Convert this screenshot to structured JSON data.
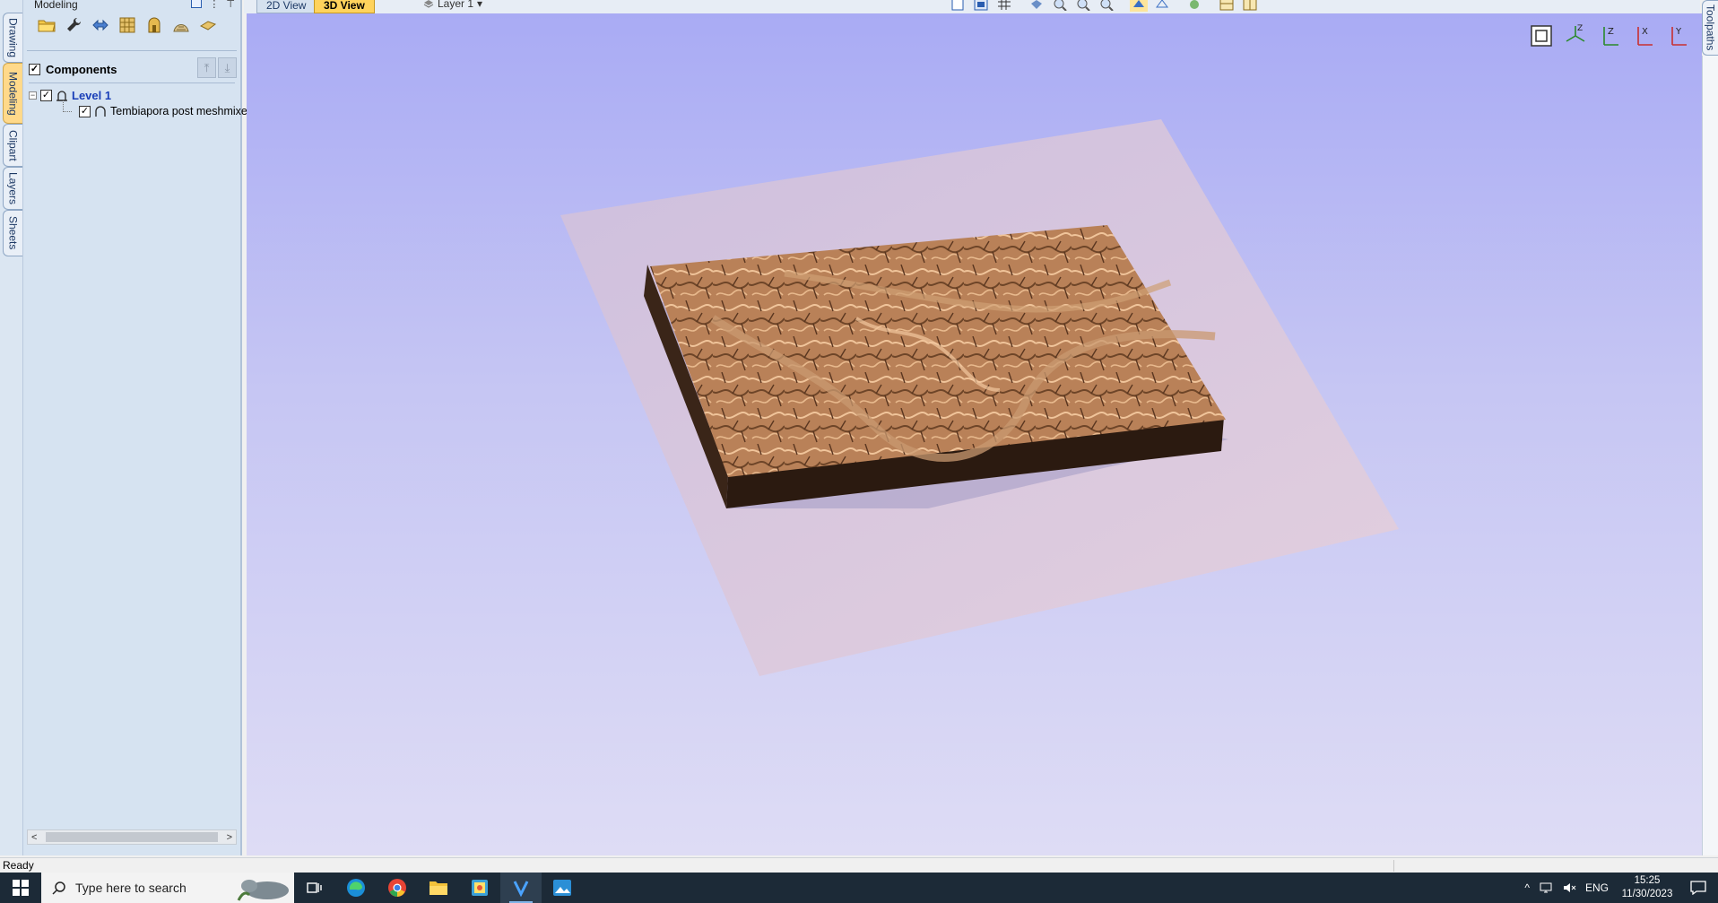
{
  "panel": {
    "title": "Modeling",
    "pin_glyph": "⋮",
    "close_glyph": "⊤",
    "tools": [
      {
        "icon": "open-folder-icon"
      },
      {
        "icon": "wrench-icon"
      },
      {
        "icon": "move-arrows-icon"
      },
      {
        "icon": "grid-texture-icon"
      },
      {
        "icon": "shape-editor-icon"
      },
      {
        "icon": "dome-icon"
      },
      {
        "icon": "flat-plane-icon"
      }
    ],
    "components_label": "Components",
    "sort_up": "⤒",
    "sort_down": "⤓",
    "tree": {
      "level_label": "Level 1",
      "expander": "−",
      "item_label": "Tembiapora post meshmixer"
    },
    "scroll_left": "<",
    "scroll_right": ">"
  },
  "side_tabs": [
    "Drawing",
    "Modeling",
    "Clipart",
    "Layers",
    "Sheets"
  ],
  "active_side_tab": "Modeling",
  "right_tab": "Toolpaths",
  "view_tabs": {
    "tab_2d": "2D View",
    "tab_3d": "3D View"
  },
  "layer_selector": {
    "label": "Layer 1",
    "arrow": "▾"
  },
  "top_toolbar_icons": [
    "page-icon",
    "fit-icon",
    "grid-icon",
    "snap-icon",
    "zoom-in-icon",
    "zoom-box-icon",
    "zoom-out-icon",
    "render-icon",
    "wireframe-icon",
    "material-icon",
    "layout-a-icon",
    "layout-b-icon"
  ],
  "view_controls": [
    {
      "icon": "zoom-fit-icon",
      "label": ""
    },
    {
      "icon": "iso-view-icon",
      "label": "Z"
    },
    {
      "icon": "top-view-icon",
      "label": "Z"
    },
    {
      "icon": "front-view-icon",
      "label": "X"
    },
    {
      "icon": "side-view-icon",
      "label": "Y"
    }
  ],
  "status": {
    "text": "Ready"
  },
  "taskbar": {
    "search_placeholder": "Type here to search",
    "apps": [
      "task-view-icon",
      "edge-icon",
      "chrome-icon",
      "file-explorer-icon",
      "store-app-icon",
      "vectric-app-icon",
      "photos-app-icon"
    ],
    "active_app": "vectric-app-icon",
    "tray_chevron": "^",
    "language": "ENG",
    "time": "15:25",
    "date": "11/30/2023"
  },
  "colors": {
    "viewport_top": "#a9abf4",
    "viewport_bottom": "#dedcf5",
    "terrain": "#b9835a",
    "terrain_side": "#3a2518",
    "sheet": "#dccbe0",
    "active_tab": "#ffd35c",
    "panel_bg": "#d6e3f1",
    "taskbar": "#1c2a37"
  }
}
